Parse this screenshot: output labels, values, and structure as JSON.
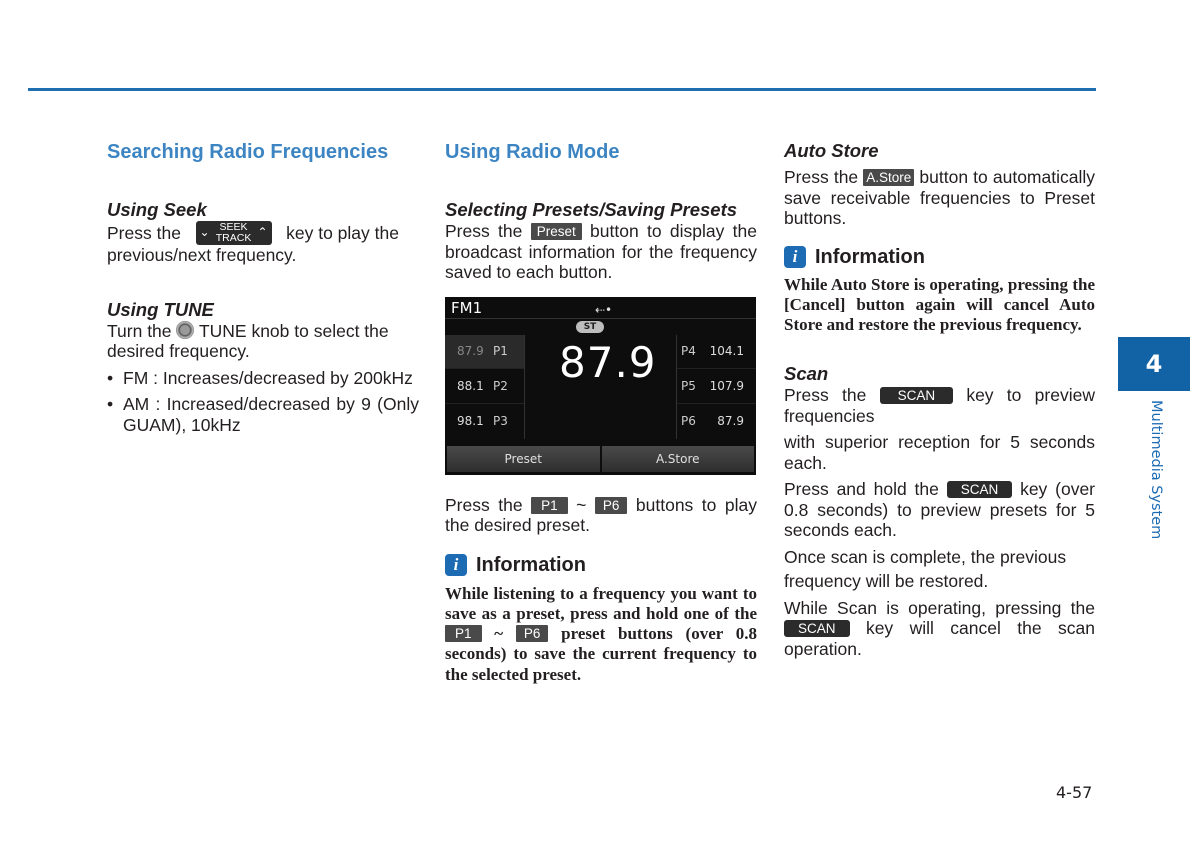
{
  "colors": {
    "accent": "#3c85c2",
    "rule": "#1f6fb0",
    "tab": "#1263a6",
    "info_icon": "#1c6bb3"
  },
  "chapter_tab": {
    "number": "4",
    "label": "Multimedia System"
  },
  "page_number": "4-57",
  "col1": {
    "title": "Searching Radio Frequencies",
    "seek": {
      "heading": "Using Seek",
      "text_before": "Press the",
      "key_top": "SEEK",
      "key_bottom": "TRACK",
      "text_after": "key to play the previous/next frequency."
    },
    "tune": {
      "heading": "Using TUNE",
      "text_before": "Turn the",
      "text_after": "TUNE knob to select the desired frequency.",
      "bullets": [
        "FM : Increases/decreased by 200kHz",
        "AM : Increased/decreased by 9 (Only GUAM), 10kHz"
      ]
    }
  },
  "col2": {
    "title": "Using Radio Mode",
    "presets": {
      "heading": "Selecting Presets/Saving Presets",
      "text_before": "Press the",
      "key": "Preset",
      "text_after": "button to display the broadcast information for the frequency saved to each button."
    },
    "screen": {
      "band": "FM1",
      "usb_icon": "usb-icon",
      "stereo": "ST",
      "frequency": "87.9",
      "left_presets": [
        {
          "freq": "87.9",
          "label": "P1",
          "active": true
        },
        {
          "freq": "88.1",
          "label": "P2"
        },
        {
          "freq": "98.1",
          "label": "P3"
        }
      ],
      "right_presets": [
        {
          "label": "P4",
          "freq": "104.1"
        },
        {
          "label": "P5",
          "freq": "107.9"
        },
        {
          "label": "P6",
          "freq": "87.9"
        }
      ],
      "buttons": [
        "Preset",
        "A.Store"
      ]
    },
    "play": {
      "text_before": "Press the",
      "key1": "P1",
      "sep": "~",
      "key2": "P6",
      "text_after": "buttons to play the desired preset."
    },
    "info": {
      "heading": "Information",
      "text_before": "While listening to a frequency you want to save as a preset, press and hold one of the",
      "key1": "P1",
      "sep": "~",
      "key2": "P6",
      "text_after": "preset buttons (over 0.8 seconds) to save the current frequency to the selected preset."
    }
  },
  "col3": {
    "autostore": {
      "heading": "Auto Store",
      "text_before": "Press the",
      "key": "A.Store",
      "text_after": "button to automatically save receivable frequencies to Preset buttons."
    },
    "info": {
      "heading": "Information",
      "text": "While Auto Store is operating, pressing the [Cancel] button again will cancel Auto Store and restore the previous frequency."
    },
    "scan": {
      "heading": "Scan",
      "key": "SCAN",
      "p1_before": "Press the",
      "p1_after": "key to preview frequencies",
      "p2": "with superior reception for 5 seconds each.",
      "p3_before": "Press and hold the",
      "p3_after": "key (over 0.8 seconds) to preview presets for 5 seconds each.",
      "p4": "Once scan is complete, the previous",
      "p5": "frequency will be restored.",
      "p6_before": "While Scan is operating, pressing the",
      "p6_after": "key will cancel the scan operation."
    }
  }
}
